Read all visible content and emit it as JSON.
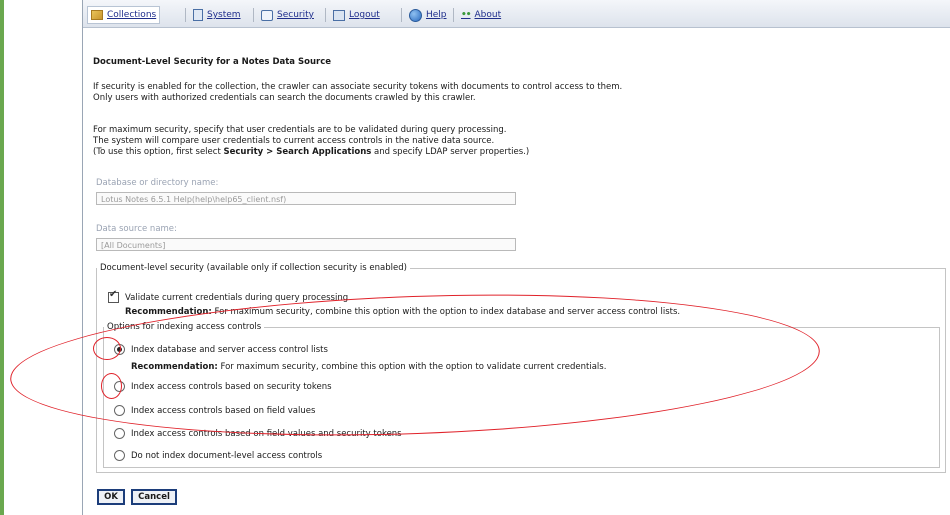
{
  "menu": {
    "collections": "Collections",
    "system": "System",
    "security": "Security",
    "logout": "Logout",
    "help": "Help",
    "about_dots": "••",
    "about": "About"
  },
  "page": {
    "title": "Document-Level Security for a Notes Data Source",
    "intro_1": "If security is enabled for the collection, the crawler can associate security tokens with documents to control access to them.",
    "intro_2": "Only users with authorized credentials can search the documents crawled by this crawler.",
    "max_1": "For maximum security, specify that user credentials are to be validated during query processing.",
    "max_2": "The system will compare user credentials to current access controls in the native data source.",
    "max_3_pre": "(To use this option, first select ",
    "max_3_bold": "Security > Search Applications",
    "max_3_post": " and specify LDAP server properties.)"
  },
  "fields": {
    "db_label": "Database or directory name:",
    "db_value": "Lotus Notes 6.5.1 Help(help\\help65_client.nsf)",
    "source_label": "Data source name:",
    "source_value": "[All Documents]"
  },
  "doc_security": {
    "legend": "Document-level security (available only if collection security is enabled)",
    "validate_label": "Validate current credentials during query processing",
    "validate_checked": true,
    "rec_label": "Recommendation:",
    "rec_text": " For maximum security, combine this option with the option to index database and server access control lists."
  },
  "index_options": {
    "legend": "Options for indexing access controls",
    "opt1": "Index database and server access control lists",
    "opt1_rec_label": "Recommendation:",
    "opt1_rec_text": " For maximum security, combine this option with the option to validate current credentials.",
    "opt2": "Index access controls based on security tokens",
    "opt3": "Index access controls based on field values",
    "opt4": "Index access controls based on field values and security tokens",
    "opt5": "Do not index document-level access controls",
    "selected": "opt1"
  },
  "buttons": {
    "ok": "OK",
    "cancel": "Cancel"
  },
  "colors": {
    "annotation": "#e0222a",
    "link": "#1f2e8c",
    "button_border": "#1c3d7a"
  }
}
